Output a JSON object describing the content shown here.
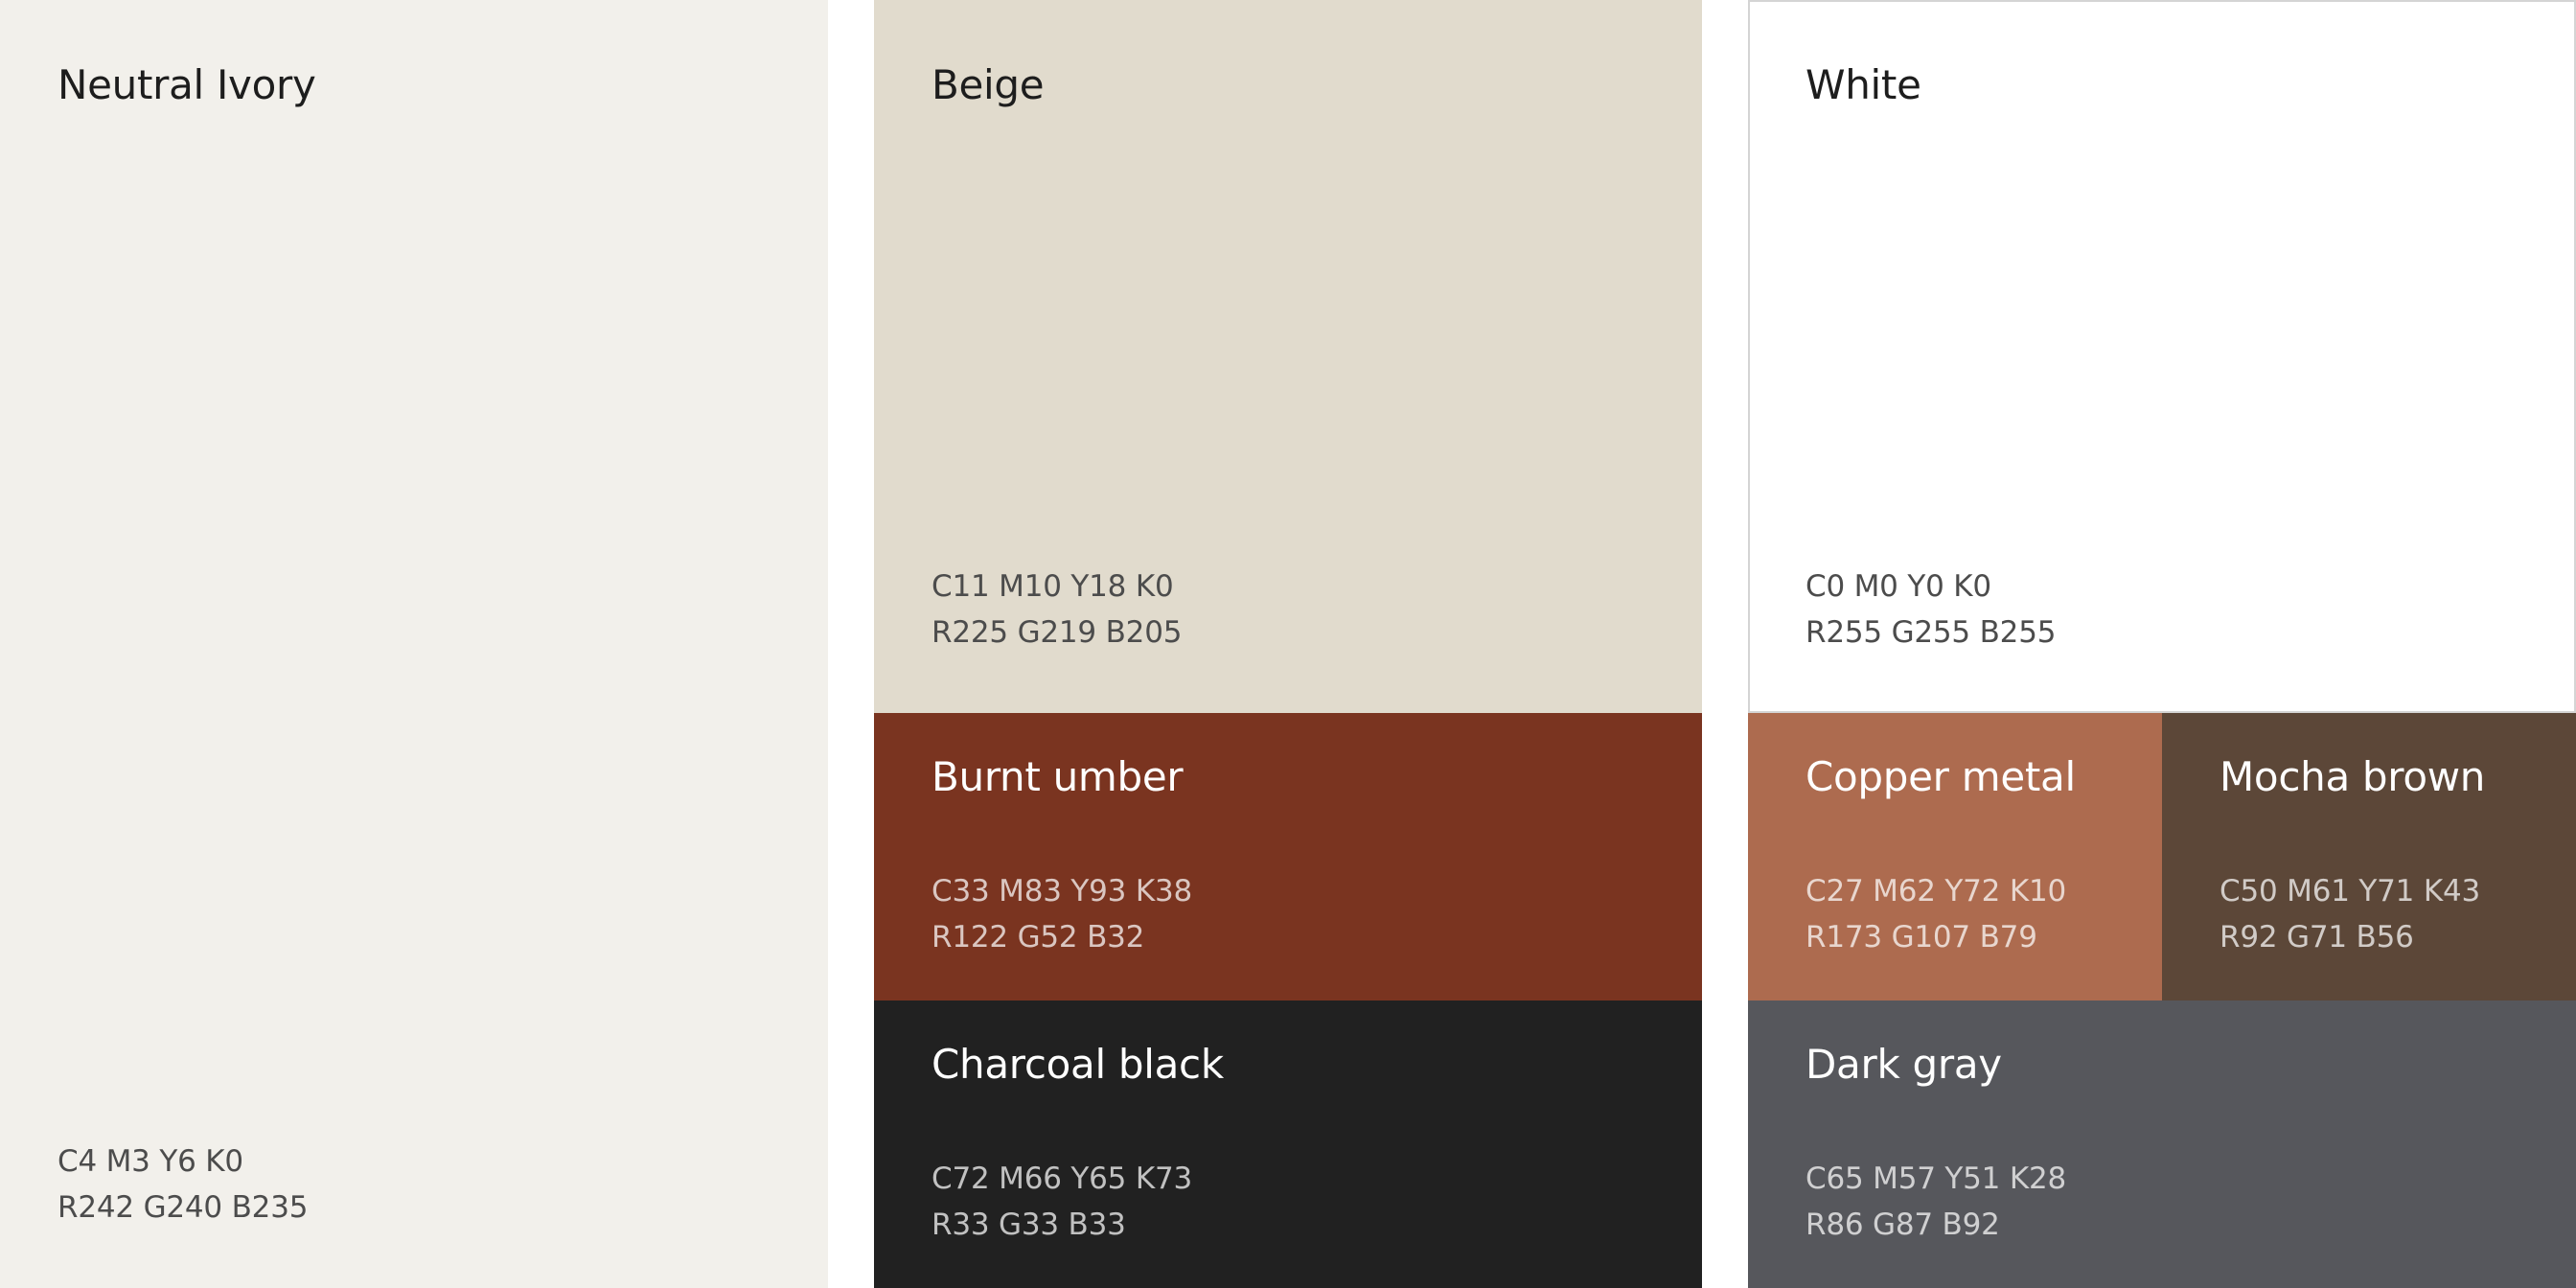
{
  "swatches": {
    "neutral_ivory": {
      "name": "Neutral Ivory",
      "cmyk": "C4 M3 Y6 K0",
      "rgb": "R242 G240 B235",
      "color": "#F2F0EB"
    },
    "beige": {
      "name": "Beige",
      "cmyk": "C11 M10 Y18 K0",
      "rgb": "R225 G219 B205",
      "color": "#E1DBCD"
    },
    "white": {
      "name": "White",
      "cmyk": "C0 M0 Y0 K0",
      "rgb": "R255 G255 B255",
      "color": "#FFFFFF"
    },
    "burnt_umber": {
      "name": "Burnt umber",
      "cmyk": "C33 M83 Y93 K38",
      "rgb": "R122 G52 B32",
      "color": "#7A3420"
    },
    "copper_metal": {
      "name": "Copper metal",
      "cmyk": "C27 M62 Y72 K10",
      "rgb": "R173 G107 B79",
      "color": "#AD6B4F"
    },
    "mocha_brown": {
      "name": "Mocha brown",
      "cmyk": "C50 M61 Y71 K43",
      "rgb": "R92 G71 B56",
      "color": "#5C4738"
    },
    "charcoal_black": {
      "name": "Charcoal black",
      "cmyk": "C72 M66 Y65 K73",
      "rgb": "R33 G33 B33",
      "color": "#212121"
    },
    "dark_gray": {
      "name": "Dark gray",
      "cmyk": "C65 M57 Y51 K28",
      "rgb": "R86 G87 B92",
      "color": "#56575C"
    }
  }
}
